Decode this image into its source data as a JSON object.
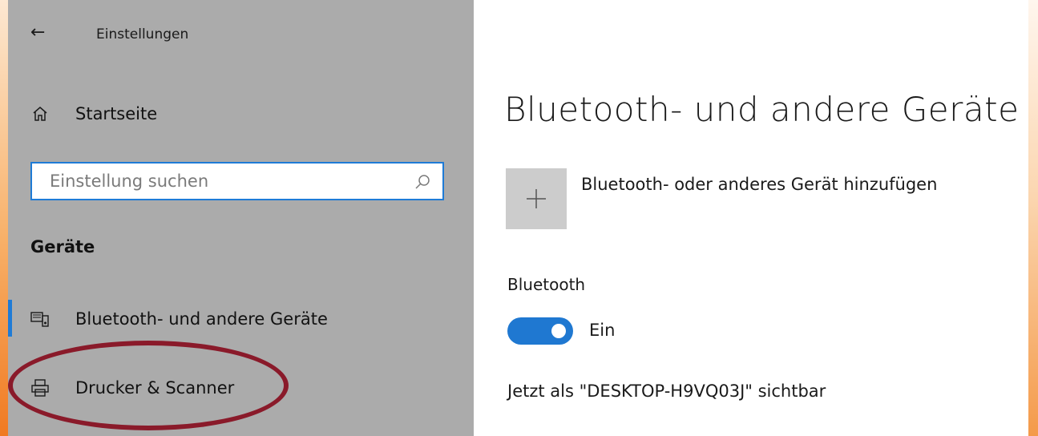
{
  "window": {
    "title": "Einstellungen"
  },
  "sidebar": {
    "home_label": "Startseite",
    "search": {
      "placeholder": "Einstellung suchen"
    },
    "section_heading": "Geräte",
    "items": [
      {
        "label": "Bluetooth- und andere Geräte",
        "icon": "keyboard-device-icon",
        "active": true
      },
      {
        "label": "Drucker & Scanner",
        "icon": "printer-icon",
        "active": false
      }
    ]
  },
  "main": {
    "title": "Bluetooth- und andere Geräte",
    "add_device_label": "Bluetooth- oder anderes Gerät hinzufügen",
    "bluetooth_label": "Bluetooth",
    "toggle_state": "Ein",
    "visibility_text": "Jetzt als \"DESKTOP-H9VQ03J\" sichtbar"
  },
  "colors": {
    "accent": "#1f78d1",
    "sidebar_bg": "#ababab",
    "annotation_ellipse": "#8a1a2a"
  }
}
